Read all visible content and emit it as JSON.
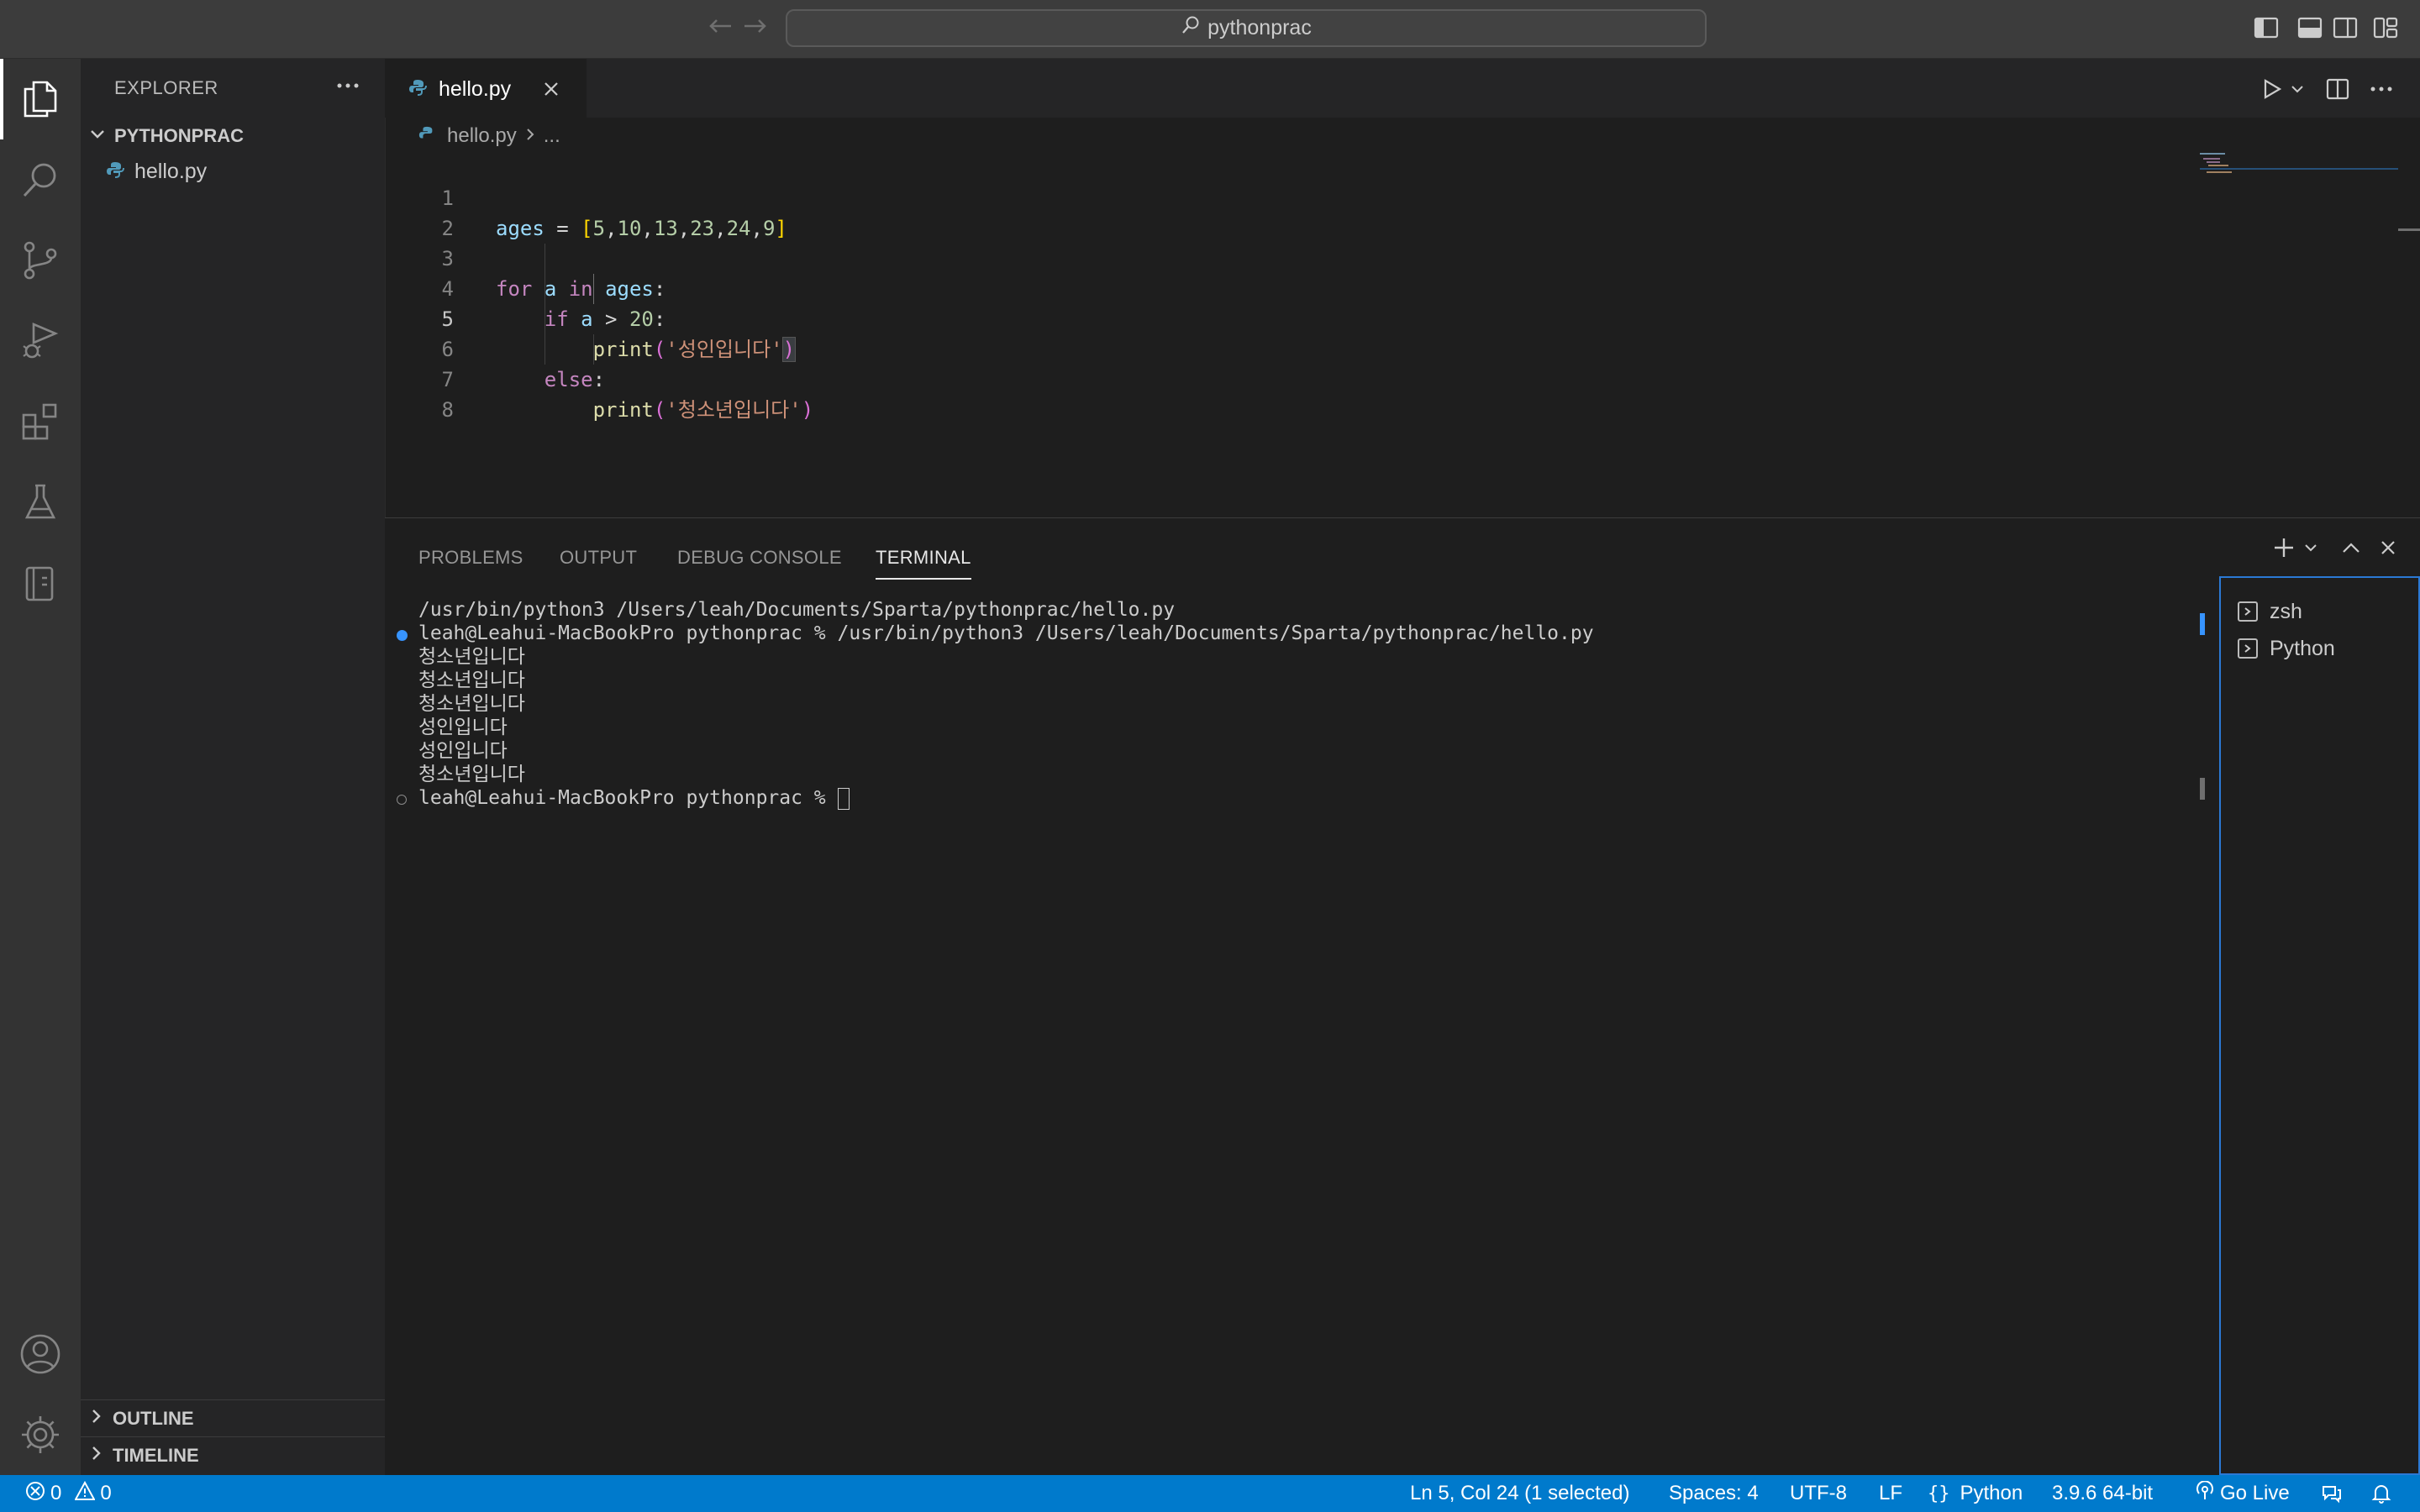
{
  "titlebar": {
    "search_text": "pythonprac"
  },
  "explorer": {
    "header": "EXPLORER",
    "project": "PYTHONPRAC",
    "files": [
      "hello.py"
    ],
    "outline_label": "OUTLINE",
    "timeline_label": "TIMELINE"
  },
  "editor": {
    "tab_label": "hello.py",
    "breadcrumb_file": "hello.py",
    "breadcrumb_more": "...",
    "line_numbers": [
      "1",
      "2",
      "3",
      "4",
      "5",
      "6",
      "7",
      "8"
    ],
    "active_line": 5
  },
  "panel": {
    "tabs": [
      "PROBLEMS",
      "OUTPUT",
      "DEBUG CONSOLE",
      "TERMINAL"
    ],
    "active_tab": "TERMINAL",
    "terminal_lines": [
      "/usr/bin/python3 /Users/leah/Documents/Sparta/pythonprac/hello.py",
      "leah@Leahui-MacBookPro pythonprac % /usr/bin/python3 /Users/leah/Documents/Sparta/pythonprac/hello.py",
      "청소년입니다",
      "청소년입니다",
      "청소년입니다",
      "성인입니다",
      "성인입니다",
      "청소년입니다",
      "leah@Leahui-MacBookPro pythonprac % "
    ],
    "terminals": [
      "zsh",
      "Python"
    ]
  },
  "statusbar": {
    "errors": "0",
    "warnings": "0",
    "cursor": "Ln 5, Col 24 (1 selected)",
    "spaces": "Spaces: 4",
    "encoding": "UTF-8",
    "eol": "LF",
    "language": "Python",
    "interpreter": "3.9.6 64-bit",
    "go_live": "Go Live"
  },
  "colors": {
    "accent": "#007acc",
    "python_icon": "#519aba"
  }
}
